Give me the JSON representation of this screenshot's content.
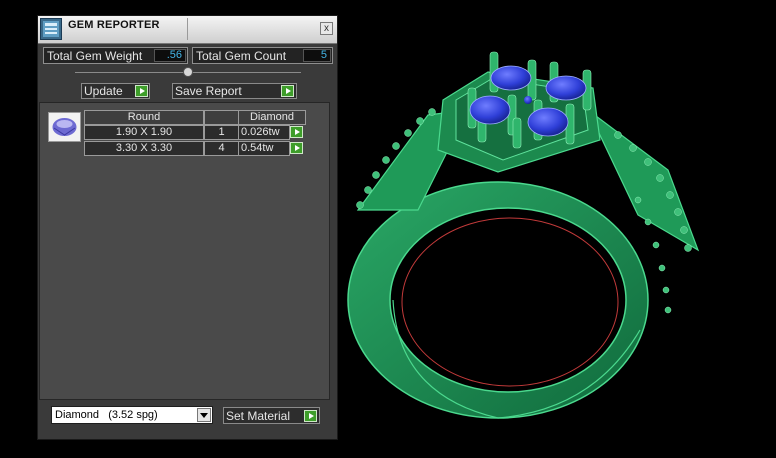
{
  "window": {
    "title": "GEM REPORTER",
    "close_glyph": "x",
    "icon": "gem-reporter-icon"
  },
  "summary": {
    "weight_label": "Total Gem Weight",
    "weight_value": ".56",
    "count_label": "Total Gem Count",
    "count_value": "5"
  },
  "slider": {
    "position": 0.5
  },
  "actions": {
    "update_label": "Update",
    "save_label": "Save Report",
    "go_icon": "green-arrow-right-icon"
  },
  "gem_table": {
    "shape_icon": "round-gem-icon",
    "headers": [
      "Round",
      "",
      "Diamond"
    ],
    "rows": [
      {
        "size": "1.90 X 1.90",
        "count": "1",
        "weight": "0.026tw"
      },
      {
        "size": "3.30 X 3.30",
        "count": "4",
        "weight": "0.54tw"
      }
    ]
  },
  "material": {
    "selected": "Diamond   (3.52 spg)",
    "set_label": "Set Material"
  },
  "colors": {
    "panel_bg": "#3a3a3a",
    "value_text": "#44b6e8",
    "go_button": "#3e9e2a",
    "ring_green": "#1e8c52",
    "gem_blue": "#2f3fd8"
  }
}
